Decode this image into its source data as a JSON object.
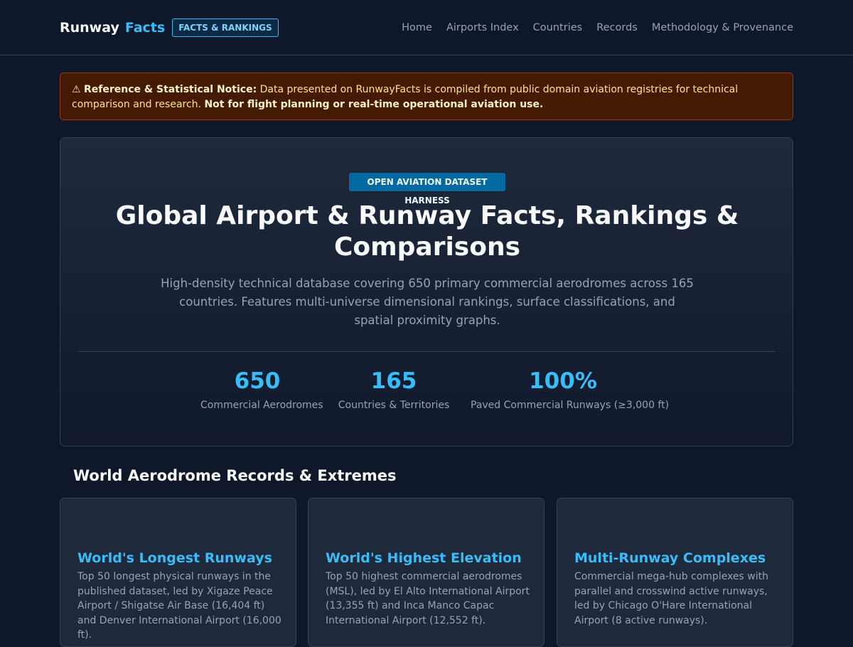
{
  "header": {
    "brand_part1": "Runway",
    "brand_part2": "Facts",
    "badge": "FACTS & RANKINGS",
    "nav": [
      "Home",
      "Airports Index",
      "Countries",
      "Records",
      "Methodology & Provenance"
    ]
  },
  "notice": {
    "icon": "⚠",
    "lead": "Reference & Statistical Notice:",
    "text": " Data presented on RunwayFacts is compiled from public domain aviation registries for technical comparison and research. ",
    "emphasis": "Not for flight planning or real-time operational aviation use."
  },
  "hero": {
    "badge": "OPEN AVIATION DATASET HARNESS",
    "title": "Global Airport & Runway Facts, Rankings & Comparisons",
    "subtitle": "High-density technical database covering 650 primary commercial aerodromes across 165 countries. Features multi-universe dimensional rankings, surface classifications, and spatial proximity graphs.",
    "stats": [
      {
        "value": "650",
        "label": "Commercial Aerodromes"
      },
      {
        "value": "165",
        "label": "Countries & Territories"
      },
      {
        "value": "100%",
        "label": "Paved Commercial Runways (≥3,000 ft)"
      }
    ]
  },
  "records": {
    "title": "World Aerodrome Records & Extremes",
    "cards": [
      {
        "title": "World's Longest Runways",
        "text": "Top 50 longest physical runways in the published dataset, led by Xigaze Peace Airport / Shigatse Air Base (16,404 ft) and Denver International Airport (16,000 ft)."
      },
      {
        "title": "World's Highest Elevation",
        "text": "Top 50 highest commercial aerodromes (MSL), led by El Alto International Airport (13,355 ft) and Inca Manco Capac International Airport (12,552 ft)."
      },
      {
        "title": "Multi-Runway Complexes",
        "text": "Commercial mega-hub complexes with parallel and crosswind active runways, led by Chicago O'Hare International Airport (8 active runways)."
      }
    ]
  }
}
